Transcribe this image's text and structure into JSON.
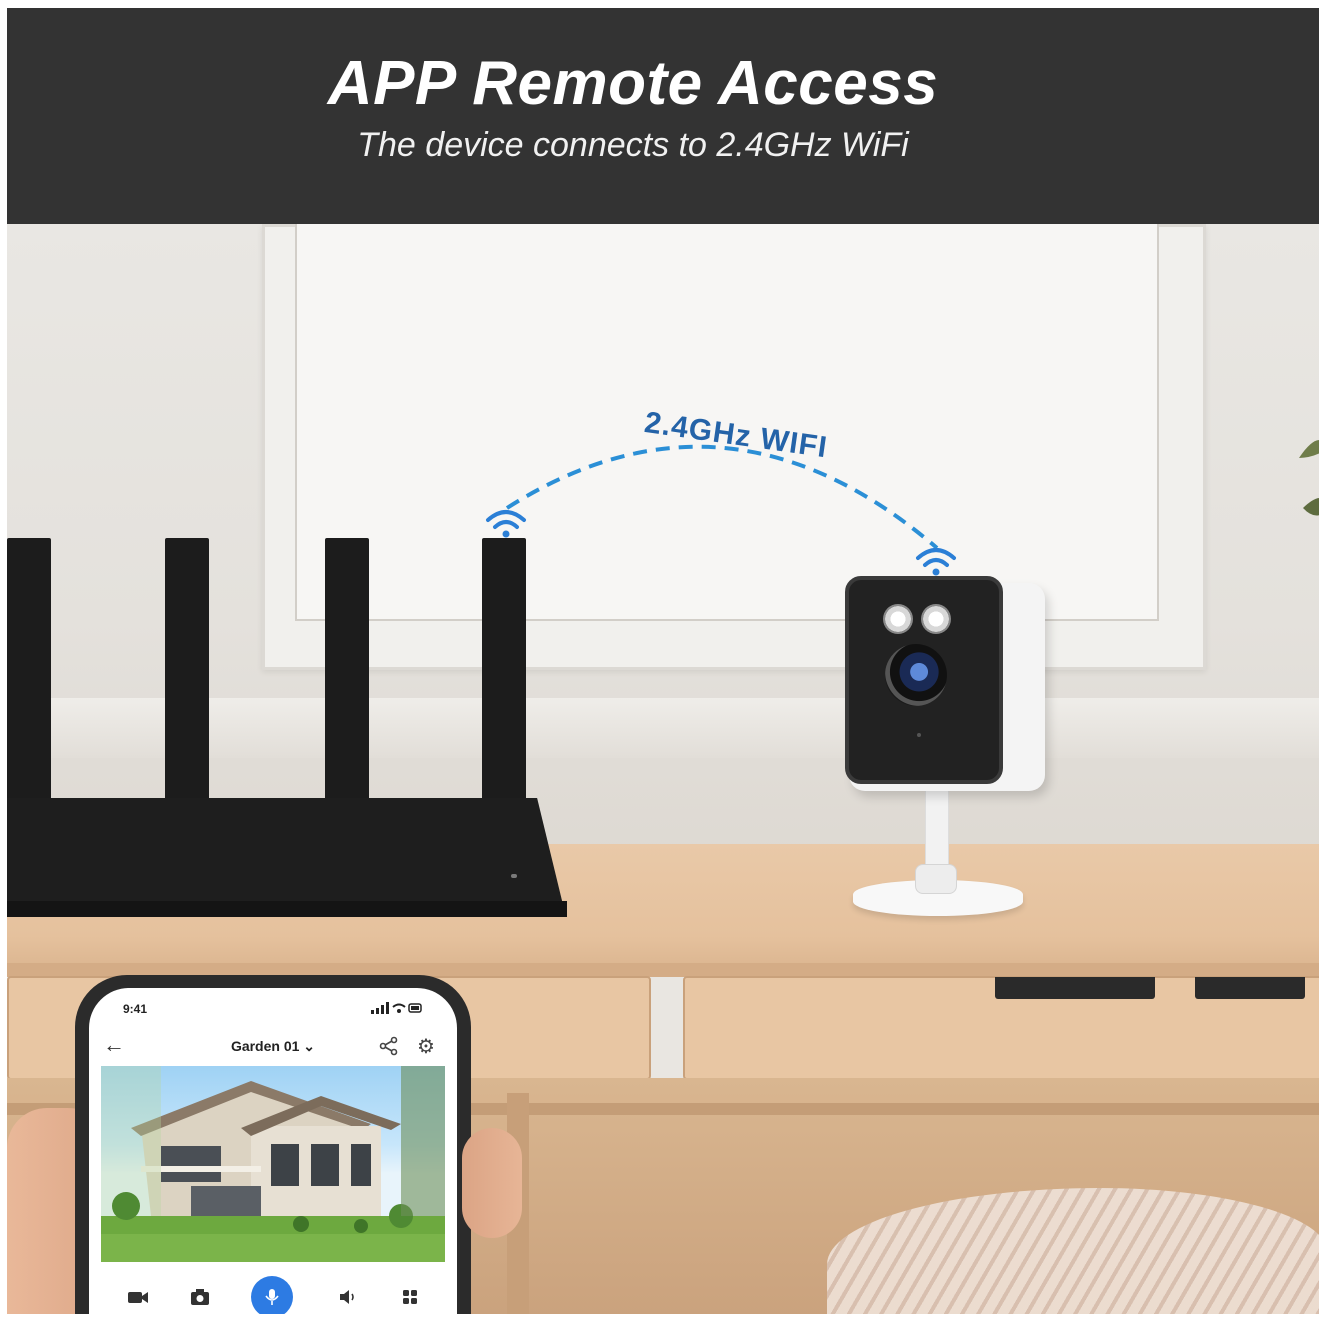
{
  "banner": {
    "title": "APP Remote Access",
    "subtitle": "The device connects to 2.4GHz WiFi"
  },
  "wifi": {
    "label": "2.4GHz WIFI",
    "color": "#2b7fd6"
  },
  "phone_app": {
    "status_time": "9:41",
    "status_icons": "signal-icon wifi-icon battery-icon",
    "camera_name": "Garden 01",
    "accent_color": "#2d7be3",
    "toolbar_icons": [
      "video-icon",
      "camera-icon",
      "microphone-icon",
      "speaker-icon",
      "grid-icon"
    ]
  }
}
